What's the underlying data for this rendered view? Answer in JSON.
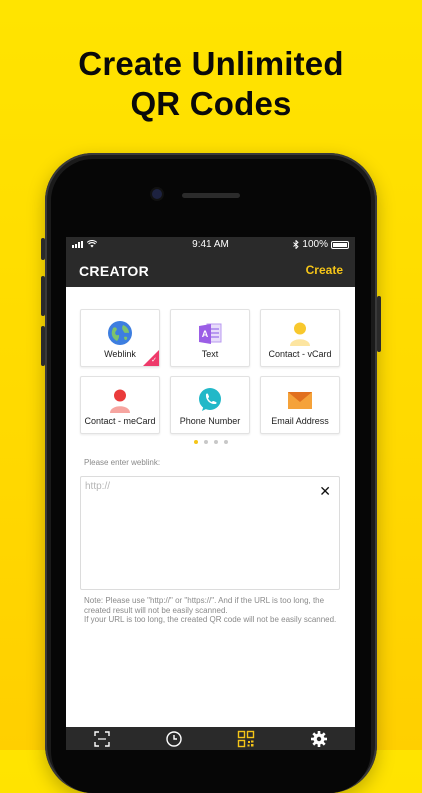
{
  "headline": {
    "line1": "Create Unlimited",
    "line2": "QR Codes"
  },
  "status_bar": {
    "time": "9:41 AM",
    "battery": "100%"
  },
  "nav": {
    "title": "CREATOR",
    "create_label": "Create"
  },
  "types": [
    {
      "label": "Weblink",
      "icon": "globe-icon",
      "selected": true
    },
    {
      "label": "Text",
      "icon": "text-document-icon",
      "selected": false
    },
    {
      "label": "Contact - vCard",
      "icon": "person-icon",
      "selected": false
    },
    {
      "label": "Contact - meCard",
      "icon": "person-red-icon",
      "selected": false
    },
    {
      "label": "Phone Number",
      "icon": "phone-icon",
      "selected": false
    },
    {
      "label": "Email Address",
      "icon": "envelope-icon",
      "selected": false
    }
  ],
  "pager": {
    "pages": 4,
    "active": 1
  },
  "form": {
    "prompt": "Please enter weblink:",
    "placeholder": "http://",
    "value": "",
    "clear_icon": "close-icon"
  },
  "note": {
    "line1": "Note: Please use \"http://\" or \"https://\". And if the URL is too long, the created result will not be easily scanned.",
    "line2": "If your URL is too long, the created QR code will not be easily scanned."
  },
  "tabbar": [
    "scan-icon",
    "history-icon",
    "qr-create-icon",
    "settings-icon"
  ],
  "colors": {
    "accent": "#f5c518",
    "background": "#ffe000",
    "bar": "#2a2a2a",
    "badge": "#ee3a6a"
  }
}
